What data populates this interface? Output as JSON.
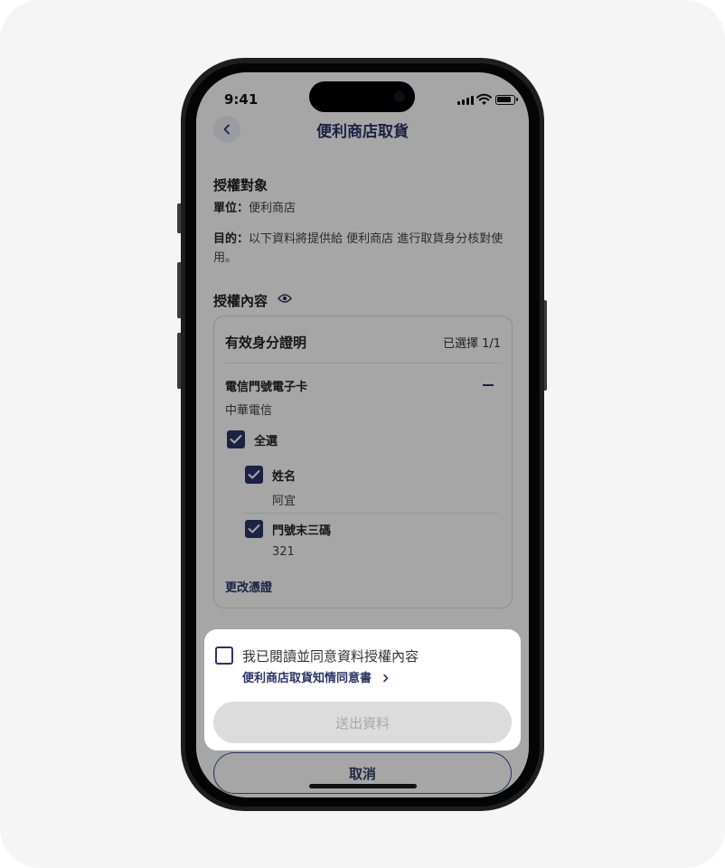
{
  "status_bar": {
    "time": "9:41",
    "icons": [
      "signal-icon",
      "wifi-icon",
      "battery-icon"
    ]
  },
  "nav": {
    "back_icon": "chevron-left-icon",
    "title": "便利商店取貨"
  },
  "authorization_target": {
    "title": "授權對象",
    "unit_label": "單位：",
    "unit_value": "便利商店",
    "purpose_label": "目的：",
    "purpose_value": "以下資料將提供給 便利商店 進行取貨身分核對使用。"
  },
  "authorization_content": {
    "title": "授權內容",
    "icon": "eye-icon",
    "card": {
      "title": "有效身分證明",
      "selected_count": "已選擇 1/1",
      "group": {
        "title": "電信門號電子卡",
        "issuer": "中華電信",
        "select_all": {
          "label": "全選",
          "checked": true
        },
        "items": [
          {
            "label": "姓名",
            "value": "阿宜",
            "checked": true
          },
          {
            "label": "門號末三碼",
            "value": "321",
            "checked": true
          }
        ]
      },
      "change_link": "更改憑證"
    }
  },
  "consent": {
    "checkbox_label": "我已閱讀並同意資料授權內容",
    "checked": false,
    "link_text": "便利商店取貨知情同意書"
  },
  "buttons": {
    "submit": "送出資料",
    "cancel": "取消"
  },
  "colors": {
    "primary": "#2b3569",
    "overlay": "rgba(0,0,0,0.35)",
    "disabled_button": "#dcdcdc"
  }
}
